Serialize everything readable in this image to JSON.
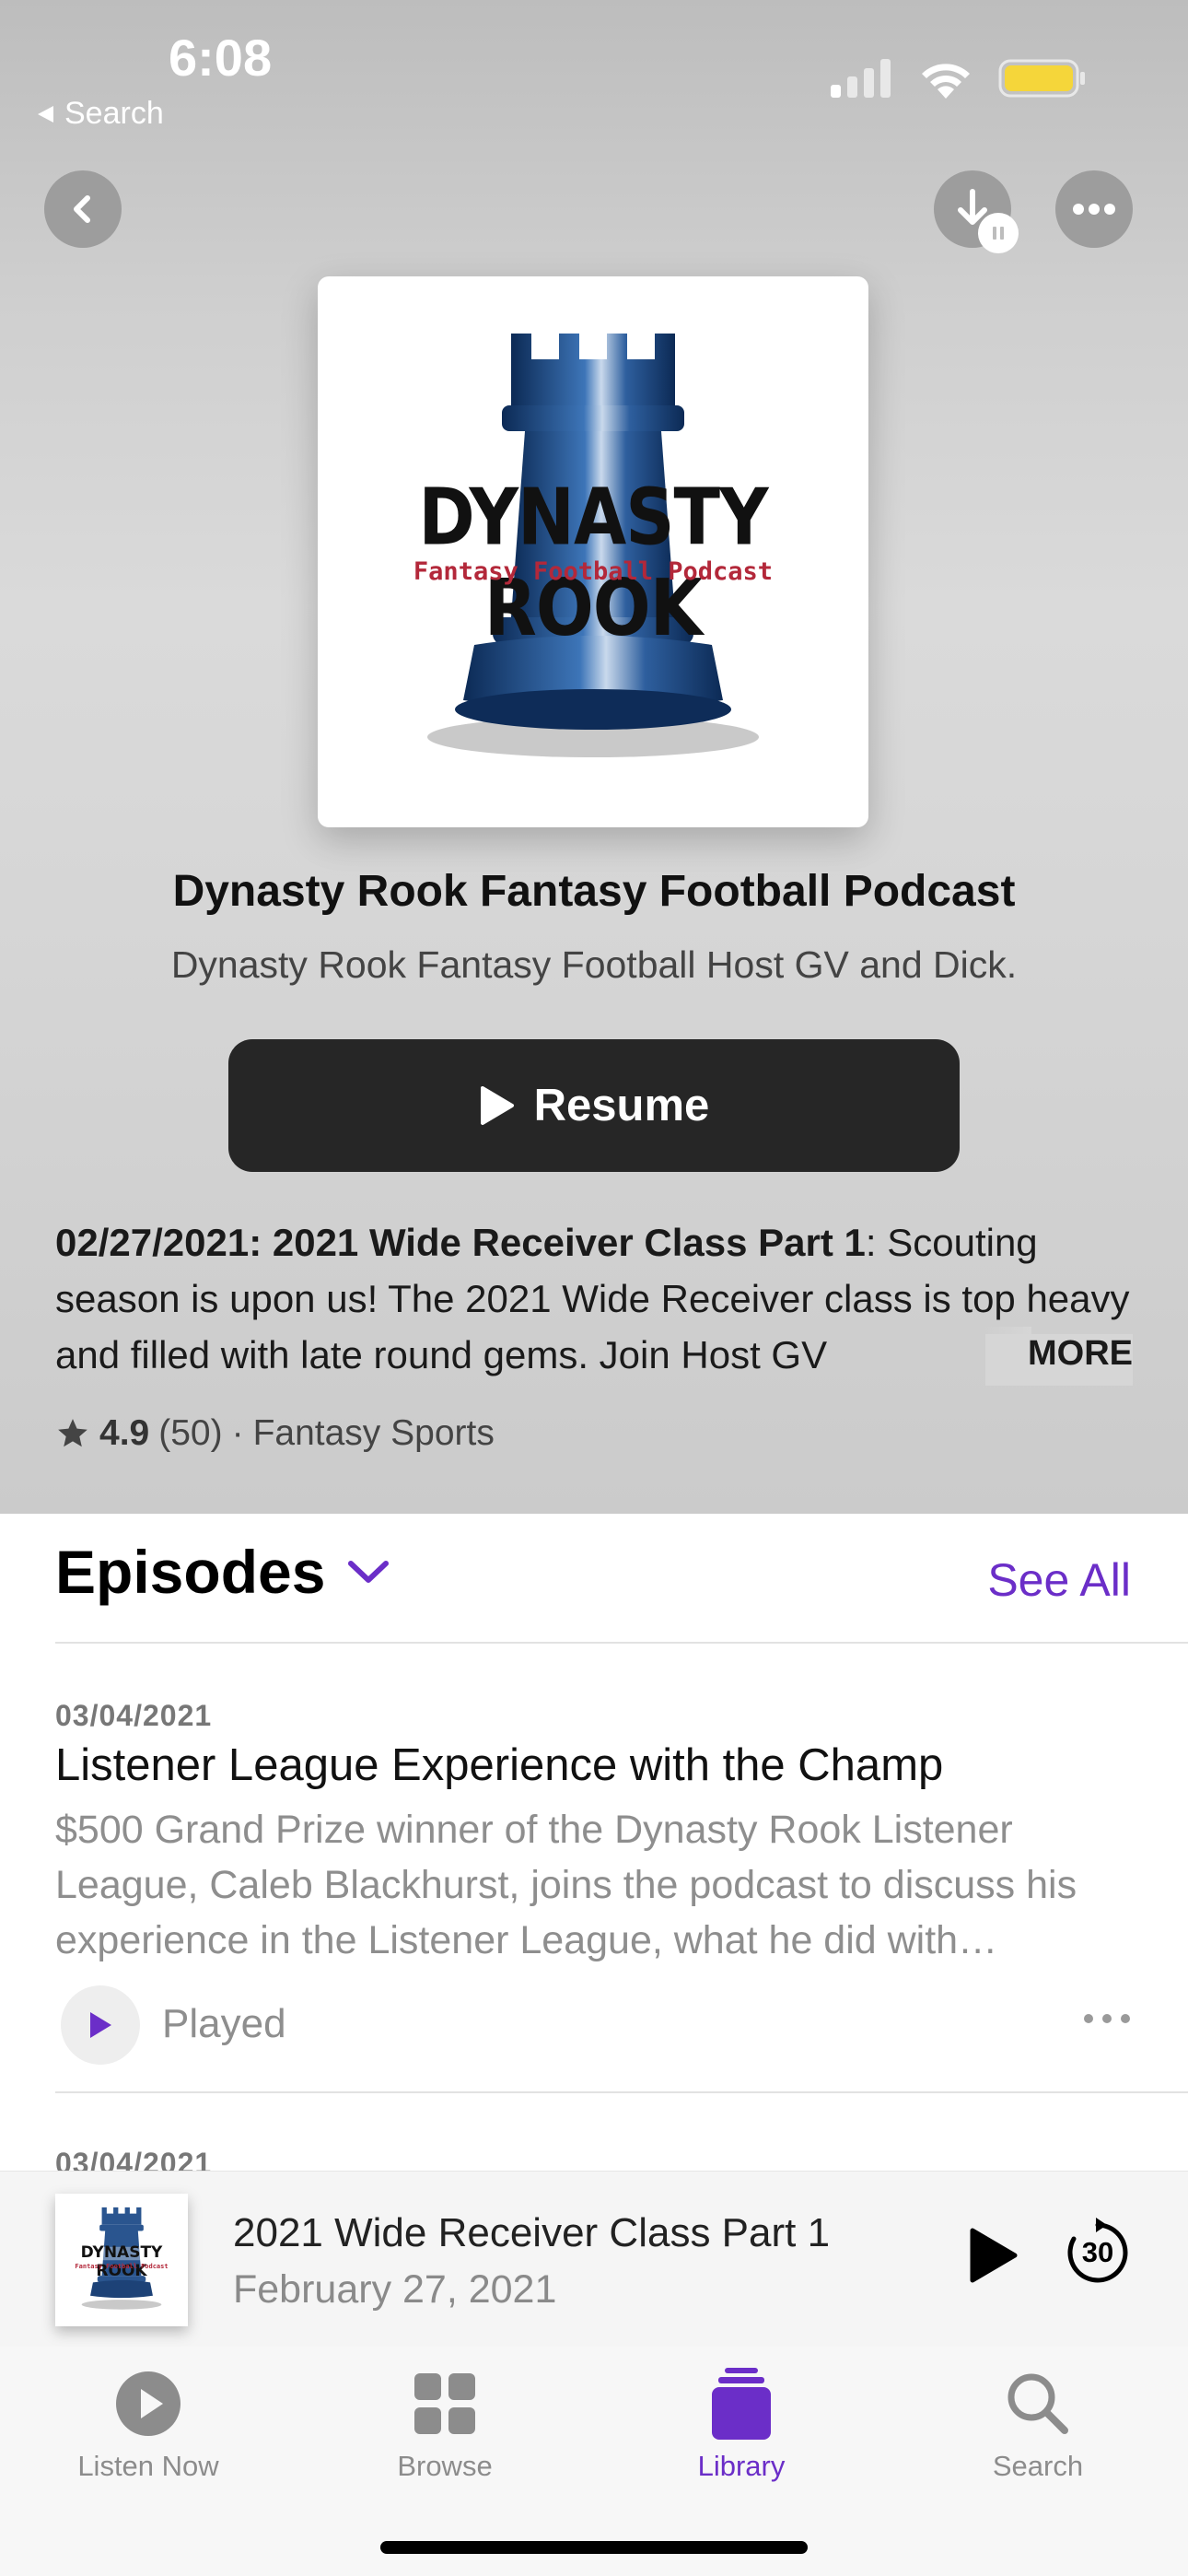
{
  "status_bar": {
    "time": "6:08",
    "back_label": "Search"
  },
  "colors": {
    "accent": "#6b2ec8",
    "button_dark": "#262626"
  },
  "artwork": {
    "title": "DYNASTY ROOK",
    "subtitle": "Fantasy Football Podcast"
  },
  "podcast": {
    "title": "Dynasty Rook Fantasy Football Podcast",
    "host": "Dynasty Rook Fantasy Football Host GV and Dick.",
    "resume_label": "Resume",
    "description_heading": "02/27/2021: 2021 Wide Receiver Class Part 1",
    "description_body": ": Scouting season is upon us! The 2021 Wide Receiver class is top heavy and filled with late round gems. Join Host GV",
    "more_label": "MORE",
    "rating": "4.9",
    "rating_count": "(50)",
    "separator": "·",
    "category": "Fantasy Sports"
  },
  "episodes": {
    "header": "Episodes",
    "see_all": "See All",
    "items": [
      {
        "date": "03/04/2021",
        "title": "Listener League Experience with the Champ",
        "description": "$500 Grand Prize winner of the Dynasty Rook Listener League, Caleb Blackhurst, joins the podcast to discuss his experience in the Listener League, what he did with…",
        "status": "Played"
      },
      {
        "date": "03/04/2021"
      }
    ]
  },
  "mini_player": {
    "title": "2021 Wide Receiver Class Part 1",
    "date": "February 27, 2021",
    "skip_label": "30"
  },
  "tabs": [
    {
      "label": "Listen Now",
      "icon": "play-circle-icon"
    },
    {
      "label": "Browse",
      "icon": "grid-icon"
    },
    {
      "label": "Library",
      "icon": "library-icon",
      "active": true
    },
    {
      "label": "Search",
      "icon": "search-icon"
    }
  ]
}
